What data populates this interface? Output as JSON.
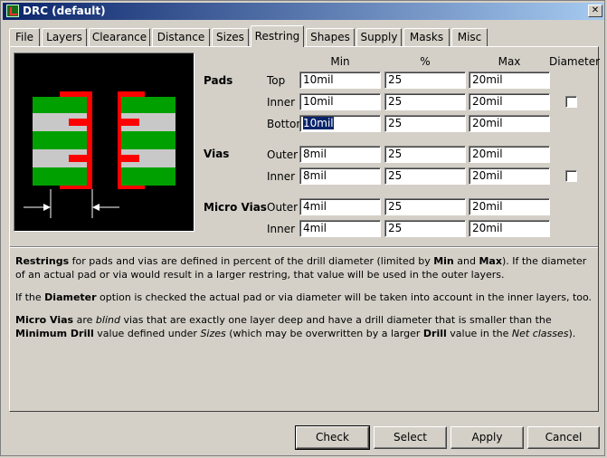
{
  "window": {
    "title": "DRC (default)"
  },
  "tabs": [
    "File",
    "Layers",
    "Clearance",
    "Distance",
    "Sizes",
    "Restring",
    "Shapes",
    "Supply",
    "Masks",
    "Misc"
  ],
  "columns": {
    "min": "Min",
    "pct": "%",
    "max": "Max",
    "diameter": "Diameter"
  },
  "groups": {
    "pads": "Pads",
    "vias": "Vias",
    "micro_vias": "Micro Vias"
  },
  "rows": {
    "pads_top": {
      "label": "Top",
      "min": "10mil",
      "pct": "25",
      "max": "20mil"
    },
    "pads_inner": {
      "label": "Inner",
      "min": "10mil",
      "pct": "25",
      "max": "20mil"
    },
    "pads_bottom": {
      "label": "Bottom",
      "min": "10mil",
      "pct": "25",
      "max": "20mil"
    },
    "vias_outer": {
      "label": "Outer",
      "min": "8mil",
      "pct": "25",
      "max": "20mil"
    },
    "vias_inner": {
      "label": "Inner",
      "min": "8mil",
      "pct": "25",
      "max": "20mil"
    },
    "micro_outer": {
      "label": "Outer",
      "min": "4mil",
      "pct": "25",
      "max": "20mil"
    },
    "micro_inner": {
      "label": "Inner",
      "min": "4mil",
      "pct": "25",
      "max": "20mil"
    }
  },
  "help": {
    "p1": {
      "b_restrings": "Restrings",
      "t1": " for pads and vias are defined in percent of the drill diameter (limited by ",
      "b_min": "Min",
      "t2": " and ",
      "b_max": "Max",
      "t3": "). If the diameter of an actual pad or via would result in a larger restring, that value will be used in the outer layers."
    },
    "p2": {
      "t1": "If the ",
      "b_diameter": "Diameter",
      "t2": " option is checked the actual pad or via diameter will be taken into account in the inner layers, too."
    },
    "p3": {
      "b_micro": "Micro Vias",
      "t1": " are ",
      "i_blind": "blind",
      "t2": " vias that are exactly one layer deep and have a drill diameter that is smaller than the ",
      "b_mindrill": "Minimum Drill",
      "t3": " value defined under ",
      "i_sizes": "Sizes",
      "t4": " (which may be overwritten by a larger ",
      "b_drill": "Drill",
      "t5": " value in the ",
      "i_netclasses": "Net classes",
      "t6": ")."
    }
  },
  "buttons": {
    "check": "Check",
    "select": "Select",
    "apply": "Apply",
    "cancel": "Cancel"
  },
  "colors": {
    "pad_green": "#00a000",
    "restring_red": "#ff0000",
    "drill_gray": "#c8c8c8",
    "title_blue": "#0a246a"
  }
}
